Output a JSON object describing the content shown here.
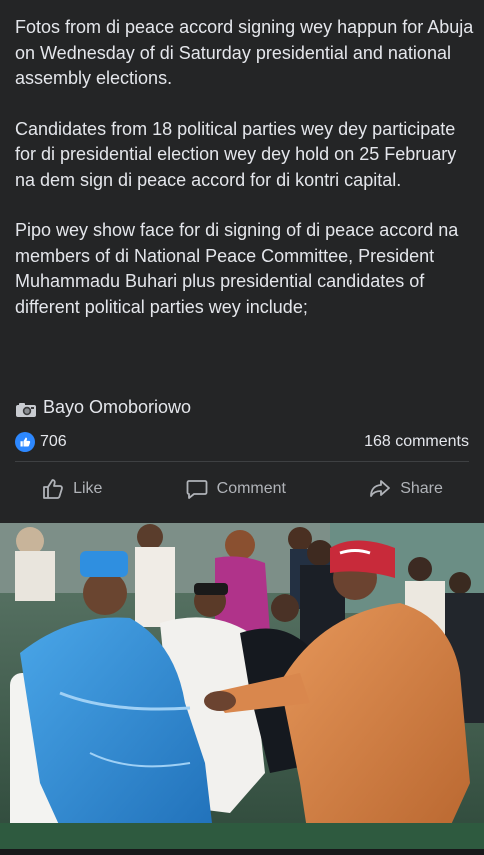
{
  "post": {
    "paragraphs": [
      "Fotos from di peace accord signing wey happun for Abuja on Wednesday of di Saturday presidential and national assembly elections.",
      "Candidates from 18 political parties wey dey participate for di presidential election wey dey hold on 25 February na dem sign di peace accord for di kontri capital.",
      "Pipo wey show face for di signing of di peace accord na members of di National Peace Committee, President Muhammadu Buhari plus presidential candidates of different political parties wey include;"
    ],
    "credit_icon": "camera-icon",
    "credit": "Bayo Omoboriowo"
  },
  "stats": {
    "likes": "706",
    "comments": "168 comments"
  },
  "actions": {
    "like": "Like",
    "comment": "Comment",
    "share": "Share"
  },
  "colors": {
    "background": "#242526",
    "text": "#e4e6eb",
    "muted": "#b0b3b8",
    "like_blue": "#2d88ff"
  }
}
